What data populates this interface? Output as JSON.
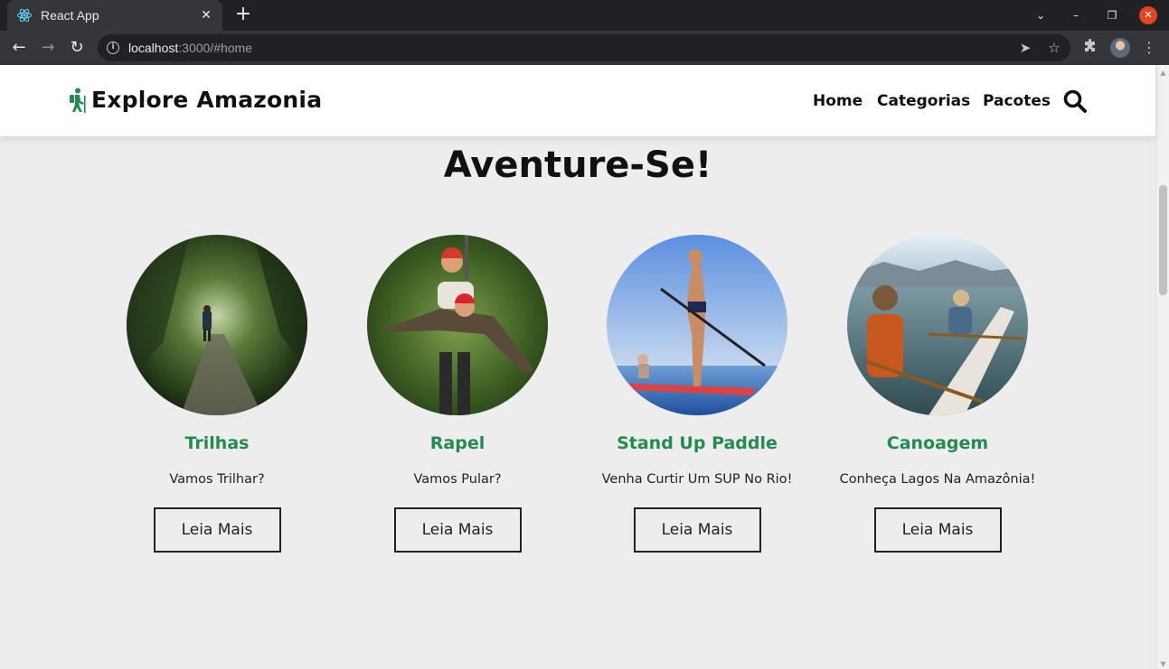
{
  "browser": {
    "tab_title": "React App",
    "tab_close": "✕",
    "new_tab": "+",
    "url_host": "localhost",
    "url_path": ":3000/#home",
    "window_controls": {
      "menu": "⌄",
      "minimize": "–",
      "restore": "❐",
      "close": "✕"
    }
  },
  "site": {
    "brand": "Explore Amazonia",
    "nav": {
      "home": "Home",
      "categorias": "Categorias",
      "pacotes": "Pacotes"
    },
    "accent_color": "#228b4f"
  },
  "section": {
    "title": "Aventure-Se!",
    "cards": [
      {
        "title": "Trilhas",
        "text": "Vamos Trilhar?",
        "button": "Leia Mais"
      },
      {
        "title": "Rapel",
        "text": "Vamos Pular?",
        "button": "Leia Mais"
      },
      {
        "title": "Stand Up Paddle",
        "text": "Venha Curtir Um SUP No Rio!",
        "button": "Leia Mais"
      },
      {
        "title": "Canoagem",
        "text": "Conheça Lagos Na Amazônia!",
        "button": "Leia Mais"
      }
    ]
  }
}
